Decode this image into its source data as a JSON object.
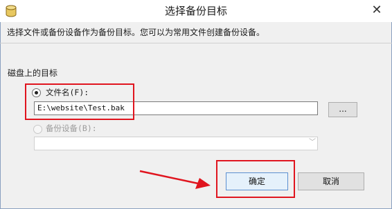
{
  "window": {
    "title": "选择备份目标",
    "close_glyph": "✕",
    "icon": "database-icon"
  },
  "dialog": {
    "description": "选择文件或备份设备作为备份目标。您可以为常用文件创建备份设备。",
    "section_label": "磁盘上的目标",
    "file_option": {
      "label": "文件名(F):",
      "selected": true
    },
    "file_path": "E:\\website\\Test.bak",
    "browse_label": "...",
    "device_option": {
      "label": "备份设备(B):",
      "selected": false,
      "enabled": false
    },
    "device_value": "",
    "device_chevron": "﹀",
    "ok_label": "确定",
    "cancel_label": "取消"
  },
  "annotations": {
    "highlight_color": "#e0141e",
    "marks": [
      "file-name-highlight-box",
      "ok-button-highlight-box",
      "arrow-to-ok"
    ]
  }
}
